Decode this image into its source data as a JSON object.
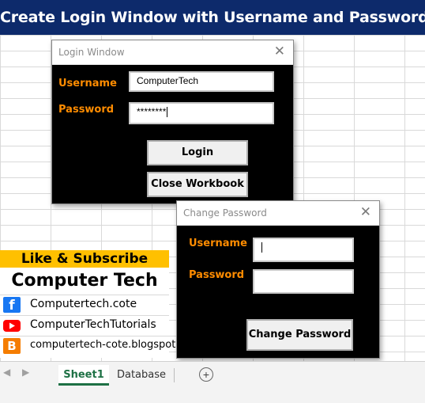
{
  "banner": {
    "title": "Create Login Window with Username and Password"
  },
  "login_window": {
    "title": "Login Window",
    "close_symbol": "✕",
    "username_label": "Username",
    "username_value": "ComputerTech",
    "password_label": "Password",
    "password_value": "********",
    "login_button": "Login",
    "close_workbook_button": "Close Workbook"
  },
  "change_password_window": {
    "title": "Change Password",
    "close_symbol": "✕",
    "username_label": "Username",
    "username_value": "",
    "password_label": "Password",
    "password_value": "",
    "change_button": "Change Password"
  },
  "promo": {
    "subscribe": "Like & Subscribe",
    "brand": "Computer Tech",
    "links": [
      {
        "icon": "facebook-icon",
        "text": "Computertech.cote",
        "color": "#1877f2"
      },
      {
        "icon": "youtube-icon",
        "text": "ComputerTechTutorials",
        "color": "#ff0000"
      },
      {
        "icon": "blogger-icon",
        "text": "computertech-cote.blogspot",
        "color": "#f57d00"
      }
    ]
  },
  "sheet_tabs": {
    "nav_prev": "◀",
    "nav_next": "▶",
    "tabs": [
      "Sheet1",
      "Database"
    ],
    "active_tab": "Sheet1",
    "add_symbol": "+"
  },
  "colors": {
    "banner": "#0d2a6b",
    "label_orange": "#ff8c00",
    "excel_green": "#1e7145",
    "subscribe_bg": "#ffc000"
  }
}
